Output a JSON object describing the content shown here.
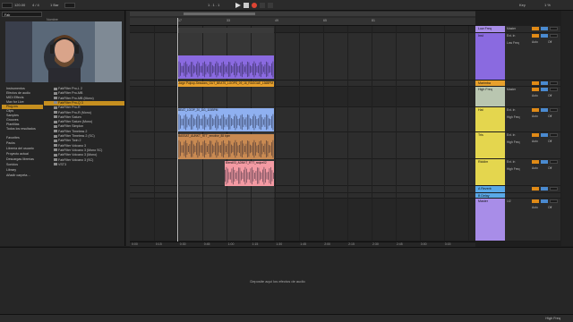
{
  "transport": {
    "tempo": "120.00",
    "signature": "4 / 4",
    "quantize": "1 Bar",
    "position": "1 . 1 . 1",
    "key": "Key",
    "cpu": "1 %"
  },
  "browser": {
    "search_value": "Fab",
    "column_header": "Nombre",
    "categories": [
      {
        "label": "Instrumentos",
        "selected": false
      },
      {
        "label": "Efectos de audio",
        "selected": false
      },
      {
        "label": "MIDI Effects",
        "selected": false
      },
      {
        "label": "Max for Live",
        "selected": false
      },
      {
        "label": "Plug-ins",
        "selected": true
      },
      {
        "label": "Clips",
        "selected": false
      },
      {
        "label": "Samples",
        "selected": false
      },
      {
        "label": "Grooves",
        "selected": false
      },
      {
        "label": "Plantillas",
        "selected": false
      },
      {
        "label": "Todos los resultados",
        "selected": false
      },
      {
        "label": "",
        "selected": false
      },
      {
        "label": "Favorites",
        "selected": false
      },
      {
        "label": "Packs",
        "selected": false
      },
      {
        "label": "Librería del usuario",
        "selected": false
      },
      {
        "label": "Proyecto actual",
        "selected": false
      },
      {
        "label": "Descargas librerías",
        "selected": false
      },
      {
        "label": "Sonidos",
        "selected": false
      },
      {
        "label": "Library",
        "selected": false
      },
      {
        "label": "Añadir carpeta…",
        "selected": false
      }
    ],
    "files": [
      {
        "label": "FabFilter Pro-L 2",
        "selected": false
      },
      {
        "label": "FabFilter Pro-MB",
        "selected": false
      },
      {
        "label": "FabFilter Pro-MB (Mono)",
        "selected": false
      },
      {
        "label": "FabFilter Pro-Q 3",
        "selected": true
      },
      {
        "label": "FabFilter Pro-R",
        "selected": false
      },
      {
        "label": "FabFilter Pro-R (Mono)",
        "selected": false
      },
      {
        "label": "FabFilter Saturn",
        "selected": false
      },
      {
        "label": "FabFilter Saturn (Mono)",
        "selected": false
      },
      {
        "label": "FabFilter Simplon",
        "selected": false
      },
      {
        "label": "FabFilter Timeless 2",
        "selected": false
      },
      {
        "label": "FabFilter Timeless 2 (SC)",
        "selected": false
      },
      {
        "label": "FabFilter Twin 2",
        "selected": false
      },
      {
        "label": "FabFilter Volcano 3",
        "selected": false
      },
      {
        "label": "FabFilter Volcano 3 (Mono SC)",
        "selected": false
      },
      {
        "label": "FabFilter Volcano 3 (Mono)",
        "selected": false
      },
      {
        "label": "FabFilter Volcano 3 (SC)",
        "selected": false
      },
      {
        "label": "VST3",
        "selected": false
      }
    ]
  },
  "ruler_ticks": [
    "17",
    "33",
    "49",
    "65",
    "81"
  ],
  "time_ticks": [
    "0:00",
    "0:15",
    "0:30",
    "0:45",
    "1:00",
    "1:15",
    "1:30",
    "1:45",
    "2:00",
    "2:15",
    "2:30",
    "2:45",
    "3:00",
    "3:15"
  ],
  "clips": [
    {
      "label": "",
      "color": "#3a3a3a"
    },
    {
      "label": "",
      "color": "#8a6ae0"
    },
    {
      "label": "Jorge Pulpop-Sessions_GUT_BEATS_LOOPS_09_16_RAGGAE_136BPM",
      "color": "#e7a02c"
    },
    {
      "label": "BEAT_LOOP_20_DG_115BPM",
      "color": "#8fb0f0"
    },
    {
      "label": "BASSAT_AUNKT_RTT_emotive_88 bpm",
      "color": "#c98a52"
    },
    {
      "label": "Blend03_ADNKT_RTT_swipe02",
      "color": "#f49aa3"
    }
  ],
  "tracks": [
    {
      "name": "Low Freq",
      "color": "#a88de8",
      "in": "Master",
      "mode": ""
    },
    {
      "name": "Inst",
      "color": "#8a6ae0",
      "in": "Ext. In",
      "mode": "Low Freq"
    },
    {
      "name": "Marimba",
      "color": "#e7a02c",
      "in": "",
      "mode": ""
    },
    {
      "name": "High Freq",
      "color": "#b9c6b0",
      "in": "Master",
      "mode": ""
    },
    {
      "name": "Hat",
      "color": "#e4d64e",
      "in": "Ext. In",
      "mode": "High Freq"
    },
    {
      "name": "Tris",
      "color": "#e4d64e",
      "in": "Ext. In",
      "mode": "High Freq"
    },
    {
      "name": "Riddim",
      "color": "#e4d64e",
      "in": "Ext. In",
      "mode": "High Freq"
    },
    {
      "name": "A Reverb",
      "color": "#5aa8e8",
      "in": "",
      "mode": ""
    },
    {
      "name": "B Delay",
      "color": "#5aa8e8",
      "in": "",
      "mode": ""
    },
    {
      "name": "Master",
      "color": "#a88de8",
      "in": "1/2",
      "mode": ""
    }
  ],
  "io_labels": {
    "auto": "Auto",
    "in_short": "In",
    "off": "Off",
    "solo": "S",
    "arm": "A"
  },
  "device": {
    "dropzone": "Deposite aquí los efectos de audio"
  },
  "status": {
    "right": "High Freq"
  },
  "colors": {
    "accent": "#e08a16",
    "selection": "#c68f1f"
  }
}
